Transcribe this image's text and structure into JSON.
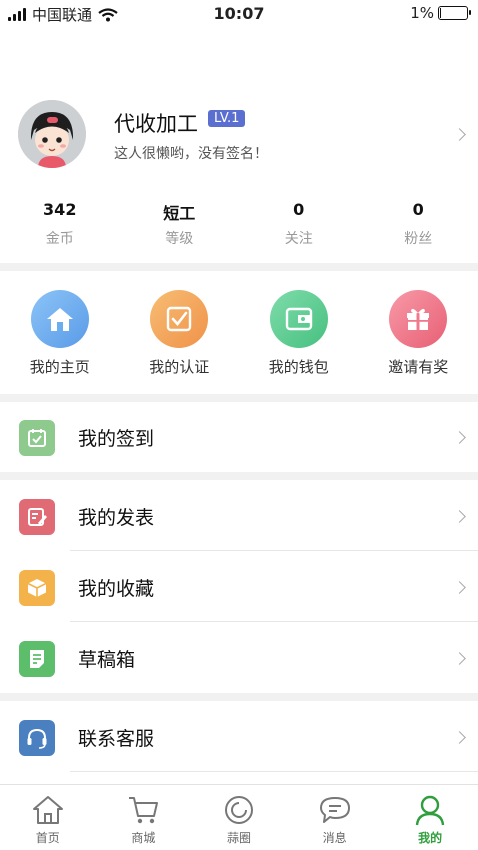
{
  "status": {
    "carrier": "中国联通",
    "time": "10:07",
    "battery": "1%"
  },
  "profile": {
    "name": "代收加工",
    "level": "LV.1",
    "signature": "这人很懒哟，没有签名！"
  },
  "stats": [
    {
      "value": "342",
      "label": "金币"
    },
    {
      "value": "短工",
      "label": "等级"
    },
    {
      "value": "0",
      "label": "关注"
    },
    {
      "value": "0",
      "label": "粉丝"
    }
  ],
  "quick": [
    {
      "label": "我的主页",
      "icon": "home-icon",
      "color": "#6aaef0"
    },
    {
      "label": "我的认证",
      "icon": "check-box-icon",
      "color": "#f3a85a"
    },
    {
      "label": "我的钱包",
      "icon": "wallet-icon",
      "color": "#5fcf94"
    },
    {
      "label": "邀请有奖",
      "icon": "gift-icon",
      "color": "#f07a8c"
    }
  ],
  "menu": {
    "checkin": {
      "label": "我的签到",
      "icon": "calendar-icon",
      "color": "#8ec98d"
    },
    "posts": {
      "label": "我的发表",
      "icon": "edit-icon",
      "color": "#e06b74"
    },
    "favorites": {
      "label": "我的收藏",
      "icon": "box-icon",
      "color": "#f3b34a"
    },
    "drafts": {
      "label": "草稿箱",
      "icon": "document-icon",
      "color": "#5cbd6a"
    },
    "support": {
      "label": "联系客服",
      "icon": "headset-icon",
      "color": "#4a7fc0"
    }
  },
  "tabs": [
    {
      "label": "首页",
      "icon": "house-icon"
    },
    {
      "label": "商城",
      "icon": "cart-icon"
    },
    {
      "label": "蒜圈",
      "icon": "circle-icon"
    },
    {
      "label": "消息",
      "icon": "chat-icon"
    },
    {
      "label": "我的",
      "icon": "person-icon",
      "active": true
    }
  ],
  "colors": {
    "accent": "#2f9e3c",
    "level_badge": "#5b6fd0"
  }
}
